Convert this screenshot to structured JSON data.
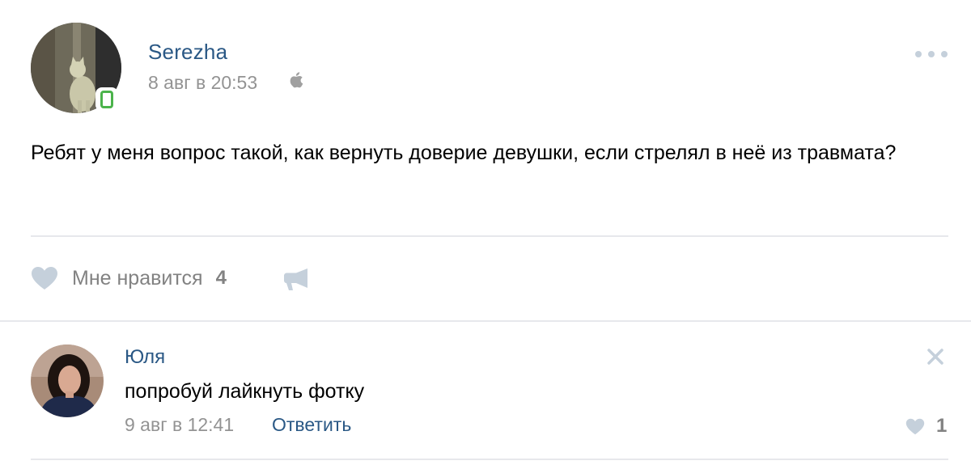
{
  "post": {
    "author": "Serezha",
    "date": "8 авг в 20:53",
    "text": "Ребят у меня вопрос такой, как вернуть доверие девушки, если стрелял в неё из травмата?",
    "icons": {
      "avatar": "avatar-cat",
      "device": "mobile-phone-icon",
      "platform": "apple-icon",
      "menu": "more-icon"
    }
  },
  "actions": {
    "like_label": "Мне нравится",
    "like_count": "4",
    "icons": {
      "like": "heart-icon",
      "share": "share-megaphone-icon"
    }
  },
  "comment": {
    "author": "Юля",
    "text": "попробуй лайкнуть фотку",
    "date": "9 авг в 12:41",
    "reply_label": "Ответить",
    "like_count": "1",
    "icons": {
      "avatar": "avatar-woman",
      "close": "close-icon",
      "like": "heart-icon"
    }
  },
  "colors": {
    "link": "#2a5885",
    "meta": "#939393",
    "action": "#828282",
    "icon": "#c5d0db",
    "divider": "#e7e8ec",
    "online_mobile": "#4bb34b"
  }
}
